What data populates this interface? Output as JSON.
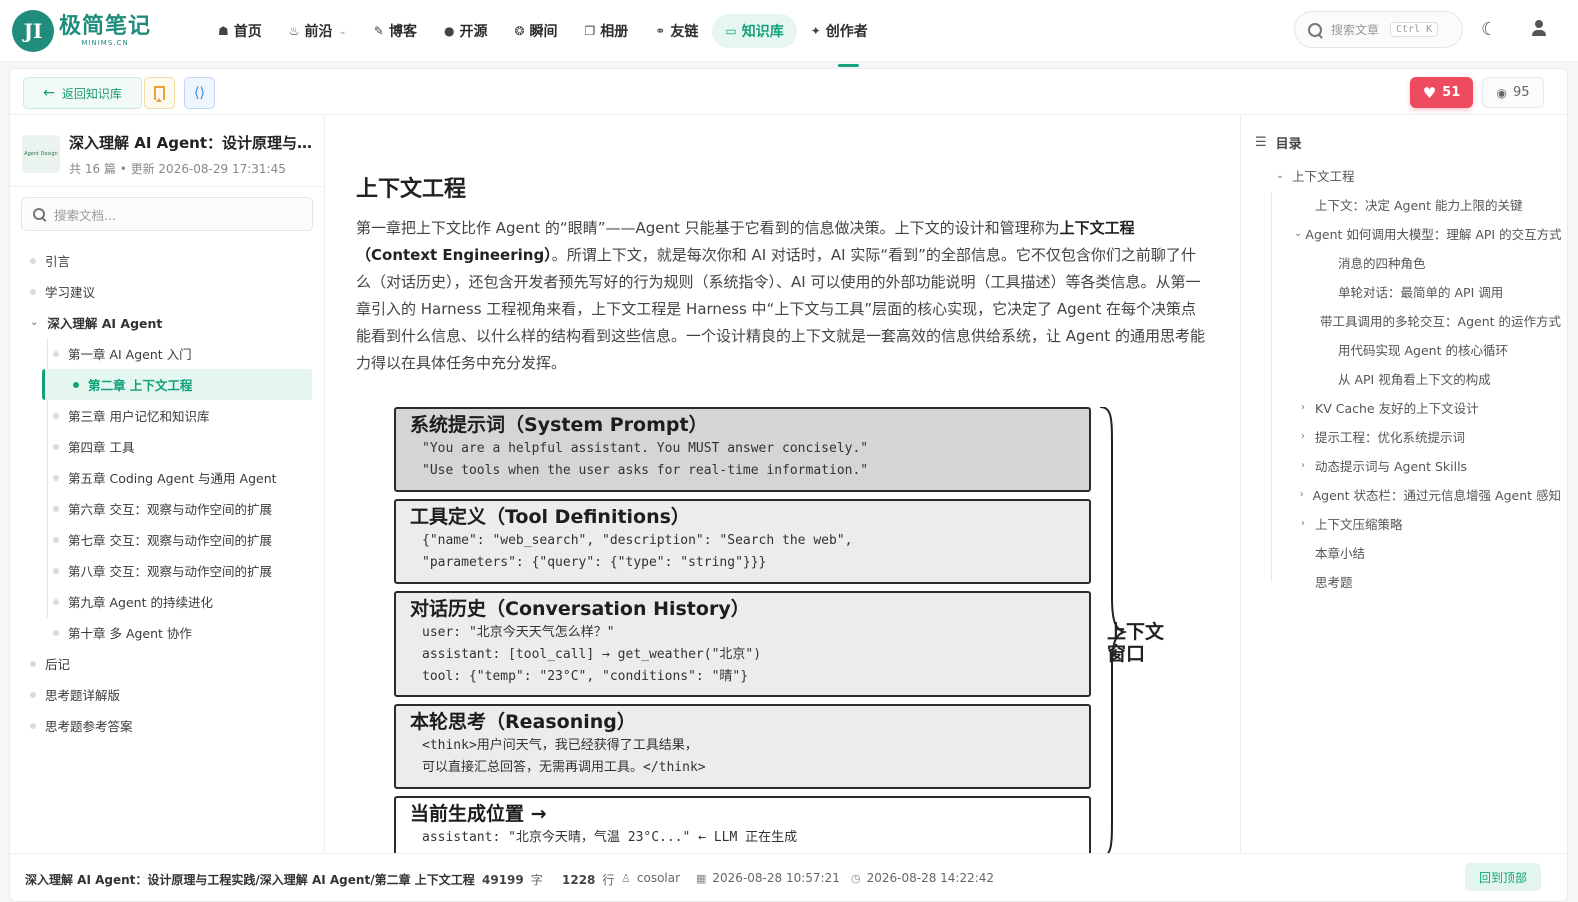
{
  "nav": {
    "logo_mark": "JI",
    "logo_title": "极简笔记",
    "logo_sub": "MINIMS.CN",
    "items": [
      {
        "icon": "home-icon",
        "glyph": "☗",
        "label": "首页"
      },
      {
        "icon": "flame-icon",
        "glyph": "♨",
        "label": "前沿",
        "dropdown": true
      },
      {
        "icon": "feather-icon",
        "glyph": "✎",
        "label": "博客"
      },
      {
        "icon": "github-icon",
        "glyph": "●",
        "label": "开源"
      },
      {
        "icon": "aperture-icon",
        "glyph": "❂",
        "label": "瞬间"
      },
      {
        "icon": "images-icon",
        "glyph": "❐",
        "label": "相册"
      },
      {
        "icon": "link-icon",
        "glyph": "⚭",
        "label": "友链"
      },
      {
        "icon": "book-icon",
        "glyph": "▭",
        "label": "知识库",
        "active": true
      },
      {
        "icon": "sparkles-icon",
        "glyph": "✦",
        "label": "创作者"
      }
    ],
    "search_placeholder": "搜索文章",
    "search_kbd": "Ctrl K"
  },
  "toolbar": {
    "back_label": "返回知识库",
    "likes": "51",
    "views": "95"
  },
  "book": {
    "cover_text": "Agent Design",
    "title": "深入理解 AI Agent：设计原理与工程实践",
    "meta": "共 16 篇 • 更新 2026-08-29 17:31:45",
    "search_placeholder": "搜索文档..."
  },
  "tree": [
    {
      "label": "引言",
      "level": 0
    },
    {
      "label": "学习建议",
      "level": 0
    },
    {
      "label": "深入理解 AI Agent",
      "level": 0,
      "open": true
    },
    {
      "label": "第一章 AI Agent 入门",
      "level": 1
    },
    {
      "label": "第二章 上下文工程",
      "level": 1,
      "current": true
    },
    {
      "label": "第三章 用户记忆和知识库",
      "level": 1
    },
    {
      "label": "第四章 工具",
      "level": 1
    },
    {
      "label": "第五章 Coding Agent 与通用 Agent",
      "level": 1
    },
    {
      "label": "第六章 交互：观察与动作空间的扩展",
      "level": 1
    },
    {
      "label": "第七章 交互：观察与动作空间的扩展",
      "level": 1
    },
    {
      "label": "第八章 交互：观察与动作空间的扩展",
      "level": 1
    },
    {
      "label": "第九章 Agent 的持续进化",
      "level": 1
    },
    {
      "label": "第十章 多 Agent 协作",
      "level": 1
    },
    {
      "label": "后记",
      "level": 0
    },
    {
      "label": "思考题详解版",
      "level": 0
    },
    {
      "label": "思考题参考答案",
      "level": 0
    }
  ],
  "article": {
    "title": "上下文工程",
    "p1": "第一章把上下文比作 Agent 的“眼睛”——Agent 只能基于它看到的信息做决策。上下文的设计和管理称为",
    "p1_bold": "上下文工程（Context Engineering）",
    "p1_rest": "。所谓上下文，就是每次你和 AI 对话时，AI 实际“看到”的全部信息。它不仅包含你们之前聊了什么（对话历史），还包含开发者预先写好的行为规则（系统指令）、AI 可以使用的外部功能说明（工具描述）等各类信息。从第一章引入的 Harness 工程视角来看，上下文工程是 Harness 中“上下文与工具”层面的核心实现，它决定了 Agent 在每个决策点能看到什么信息、以什么样的结构看到这些信息。一个设计精良的上下文就是一套高效的信息供给系统，让 Agent 的通用思考能力得以在具体任务中充分发挥。"
  },
  "diagram": {
    "blocks": [
      {
        "title": "系统提示词（System Prompt）",
        "lines": [
          "\"You are a helpful assistant. You MUST answer concisely.\"",
          "\"Use tools when the user asks for real-time information.\""
        ]
      },
      {
        "title": "工具定义（Tool Definitions）",
        "lines": [
          "{\"name\": \"web_search\", \"description\": \"Search the web\",",
          "\"parameters\": {\"query\": {\"type\": \"string\"}}}"
        ]
      },
      {
        "title": "对话历史（Conversation History）",
        "lines": [
          "user: \"北京今天天气怎么样？\"",
          "assistant: [tool_call] → get_weather(\"北京\")",
          "tool: {\"temp\": \"23°C\", \"conditions\": \"晴\"}"
        ]
      },
      {
        "title": "本轮思考（Reasoning）",
        "lines": [
          "<think>用户问天气，我已经获得了工具结果，",
          "可以直接汇总回答，无需再调用工具。</think>"
        ]
      },
      {
        "title": "当前生成位置 →",
        "lines": [
          "assistant: \"北京今天晴，气温 23°C...\" ← LLM 正在生成"
        ]
      }
    ],
    "side_label": "上下文窗口"
  },
  "toc": {
    "title": "目录",
    "items": [
      {
        "label": "上下文工程",
        "depth": 1,
        "caret": "⌄"
      },
      {
        "label": "上下文：决定 Agent 能力上限的关键",
        "depth": 2,
        "caret": ""
      },
      {
        "label": "Agent 如何调用大模型：理解 API 的交互方式",
        "depth": 2,
        "caret": "⌄"
      },
      {
        "label": "消息的四种角色",
        "depth": 3,
        "caret": ""
      },
      {
        "label": "单轮对话：最简单的 API 调用",
        "depth": 3,
        "caret": ""
      },
      {
        "label": "带工具调用的多轮交互：Agent 的运作方式",
        "depth": 3,
        "caret": ""
      },
      {
        "label": "用代码实现 Agent 的核心循环",
        "depth": 3,
        "caret": ""
      },
      {
        "label": "从 API 视角看上下文的构成",
        "depth": 3,
        "caret": ""
      },
      {
        "label": "KV Cache 友好的上下文设计",
        "depth": 2,
        "caret": "›"
      },
      {
        "label": "提示工程：优化系统提示词",
        "depth": 2,
        "caret": "›"
      },
      {
        "label": "动态提示词与 Agent Skills",
        "depth": 2,
        "caret": "›"
      },
      {
        "label": "Agent 状态栏：通过元信息增强 Agent 感知",
        "depth": 2,
        "caret": "›"
      },
      {
        "label": "上下文压缩策略",
        "depth": 2,
        "caret": "›"
      },
      {
        "label": "本章小结",
        "depth": 2,
        "caret": ""
      },
      {
        "label": "思考题",
        "depth": 2,
        "caret": ""
      }
    ]
  },
  "status": {
    "path": "深入理解 AI Agent：设计原理与工程实践/深入理解 AI Agent/第二章 上下文工程",
    "words": "49199",
    "words_unit": "字",
    "lines": "1228",
    "lines_unit": "行",
    "author": "cosolar",
    "created": "2026-08-28 10:57:21",
    "updated": "2026-08-28 14:22:42",
    "top_label": "回到顶部"
  }
}
